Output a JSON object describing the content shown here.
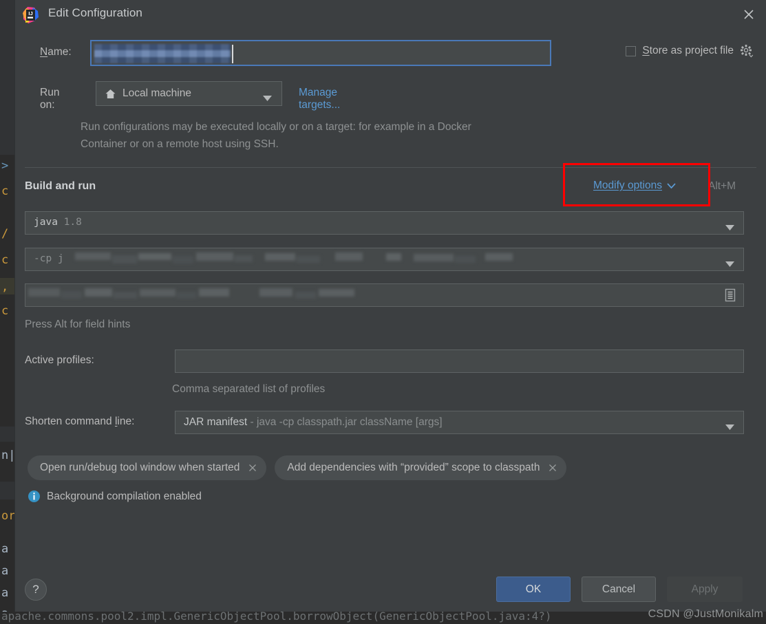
{
  "window": {
    "title": "Edit Configuration",
    "logo_icon": "intellij-idea-logo",
    "close_icon": "close-icon"
  },
  "name_row": {
    "label": "Name:",
    "label_mnemonic": "N",
    "value": "",
    "redacted": true
  },
  "store_as_project_file": {
    "label": "Store as project file",
    "label_mnemonic": "S",
    "checked": false,
    "gear_icon": "gear-icon"
  },
  "run_on": {
    "label": "Run on:",
    "value": "Local machine",
    "value_icon": "home-icon",
    "manage_targets_link": "Manage targets...",
    "description": "Run configurations may be executed locally or on a target: for example in a Docker Container or on a remote host using SSH."
  },
  "build_and_run": {
    "section_title": "Build and run",
    "modify_options_link": "Modify options",
    "modify_options_mnemonic": "M",
    "modify_options_shortcut": "Alt+M",
    "jdk_field": {
      "command": "java",
      "version": "1.8"
    },
    "classpath_field": {
      "prefix": "-cp j",
      "value": "",
      "redacted": true
    },
    "main_class_field": {
      "value": "",
      "redacted": true,
      "expand_icon": "expand-editor-icon"
    },
    "field_hint": "Press Alt for field hints"
  },
  "active_profiles": {
    "label": "Active profiles:",
    "value": "",
    "hint": "Comma separated list of profiles"
  },
  "shorten_command_line": {
    "label": "Shorten command line:",
    "label_mnemonic": "l",
    "value": "JAR manifest",
    "value_detail": " - java -cp classpath.jar className [args]"
  },
  "option_chips": [
    {
      "label": "Open run/debug tool window when started",
      "remove_icon": "close-icon"
    },
    {
      "label": "Add dependencies with “provided” scope to classpath",
      "remove_icon": "close-icon"
    }
  ],
  "status_message": {
    "icon": "info-icon",
    "text": "Background compilation enabled"
  },
  "footer": {
    "help_label": "?",
    "ok_label": "OK",
    "cancel_label": "Cancel",
    "apply_label": "Apply",
    "apply_enabled": false
  },
  "watermark": "CSDN @JustMonikalm",
  "editor_backdrop": {
    "visible_chars": [
      ">",
      "c",
      "/",
      "c",
      ",",
      "c",
      "n|",
      "or",
      "a",
      "a",
      "a",
      "a"
    ],
    "bottom_line": "apache.commons.pool2.impl.GenericObjectPool.borrowObject(GenericObjectPool.java:4?)"
  },
  "colors": {
    "dialog_bg": "#3c3f41",
    "field_bg": "#45494a",
    "accent_link": "#5b9bd5",
    "focus_border": "#4a79b8",
    "highlight_box": "#ff0000",
    "ok_button": "#3c5c8c",
    "info_icon": "#3592c4"
  }
}
